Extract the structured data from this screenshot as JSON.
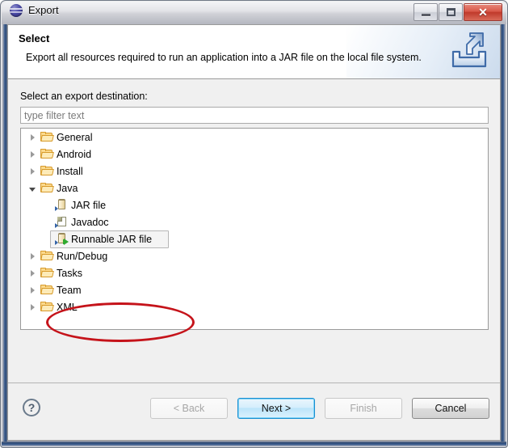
{
  "window": {
    "title": "Export",
    "logo_icon": "eclipse-logo",
    "buttons": {
      "minimize": "minimize-icon",
      "maximize": "restore-icon",
      "close": "✕"
    }
  },
  "header": {
    "title": "Select",
    "description": "Export all resources required to run an application into a JAR file on the local file system.",
    "icon": "export-wizard-icon"
  },
  "body": {
    "destination_label": "Select an export destination:",
    "filter": {
      "placeholder": "type filter text",
      "value": ""
    },
    "tree": [
      {
        "label": "General",
        "icon": "folder-icon",
        "level": 0,
        "state": "collapsed",
        "selected": false
      },
      {
        "label": "Android",
        "icon": "folder-icon",
        "level": 0,
        "state": "collapsed",
        "selected": false
      },
      {
        "label": "Install",
        "icon": "folder-icon",
        "level": 0,
        "state": "collapsed",
        "selected": false
      },
      {
        "label": "Java",
        "icon": "folder-icon",
        "level": 0,
        "state": "expanded",
        "selected": false
      },
      {
        "label": "JAR file",
        "icon": "jar-file-icon",
        "level": 1,
        "state": "leaf",
        "selected": false
      },
      {
        "label": "Javadoc",
        "icon": "javadoc-icon",
        "level": 1,
        "state": "leaf",
        "selected": false
      },
      {
        "label": "Runnable JAR file",
        "icon": "runnable-jar-icon",
        "level": 1,
        "state": "leaf",
        "selected": true
      },
      {
        "label": "Run/Debug",
        "icon": "folder-icon",
        "level": 0,
        "state": "collapsed",
        "selected": false
      },
      {
        "label": "Tasks",
        "icon": "folder-icon",
        "level": 0,
        "state": "collapsed",
        "selected": false
      },
      {
        "label": "Team",
        "icon": "folder-icon",
        "level": 0,
        "state": "collapsed",
        "selected": false
      },
      {
        "label": "XML",
        "icon": "folder-icon",
        "level": 0,
        "state": "collapsed",
        "selected": false
      }
    ],
    "annotation": {
      "shape": "ellipse",
      "color": "#c5131a",
      "targets": "Runnable JAR file"
    }
  },
  "footer": {
    "help_icon": "?",
    "buttons": [
      {
        "label": "< Back",
        "name": "back-button",
        "state": "disabled"
      },
      {
        "label": "Next >",
        "name": "next-button",
        "state": "default"
      },
      {
        "label": "Finish",
        "name": "finish-button",
        "state": "disabled"
      },
      {
        "label": "Cancel",
        "name": "cancel-button",
        "state": "normal"
      }
    ]
  },
  "colors": {
    "accent": "#1a8fd1",
    "annotation": "#c5131a",
    "folder": "#fbd98c",
    "titlebar_close": "#c0392b"
  }
}
